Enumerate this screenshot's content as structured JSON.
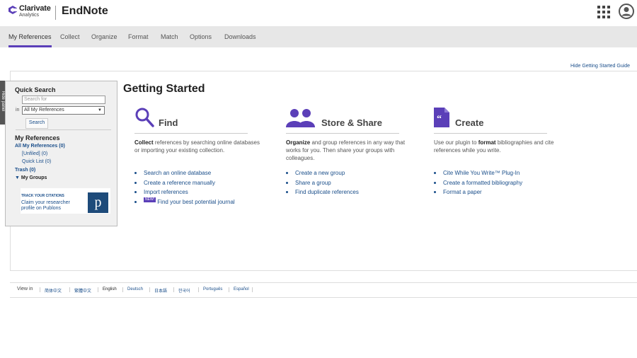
{
  "header": {
    "brand": "Clarivate",
    "brand_sub": "Analytics",
    "app_name": "EndNote",
    "apps_icon": "grid-apps-icon",
    "user_icon": "user-account-icon"
  },
  "nav": {
    "tabs": [
      {
        "label": "My References",
        "active": true
      },
      {
        "label": "Collect"
      },
      {
        "label": "Organize"
      },
      {
        "label": "Format"
      },
      {
        "label": "Match"
      },
      {
        "label": "Options"
      },
      {
        "label": "Downloads"
      }
    ]
  },
  "hide_guide_label": "Hide Getting Started Guide",
  "side_tab_label": "Hide panel",
  "quick_search": {
    "title": "Quick Search",
    "placeholder": "Search for",
    "in_label": "in",
    "select_value": "All My References",
    "button_label": "Search"
  },
  "my_references": {
    "title": "My References",
    "all": "All My References (0)",
    "unfiled": "[Unfiled] (0)",
    "quick_list": "Quick List (0)",
    "trash": "Trash (0)",
    "groups": "My Groups"
  },
  "publons": {
    "line1": "TRACK YOUR CITATIONS",
    "line2": "Claim your researcher",
    "line3": "profile on Publons",
    "logo_letter": "p"
  },
  "getting_started": {
    "title": "Getting Started",
    "find": {
      "icon": "magnifier-icon",
      "heading": "Find",
      "desc_bold": "Collect",
      "desc_rest": " references by searching online databases or importing your existing collection.",
      "links": [
        "Search an online database",
        "Create a reference manually",
        "Import references"
      ],
      "new_badge": "NEW!",
      "new_link": "Find your best potential journal"
    },
    "store": {
      "icon": "group-users-icon",
      "heading": "Store & Share",
      "desc_bold": "Organize",
      "desc_rest": " and group references in any way that works for you. Then share your groups with colleagues.",
      "links": [
        "Create a new group",
        "Share a group",
        "Find duplicate references"
      ]
    },
    "create": {
      "icon": "quote-document-icon",
      "heading": "Create",
      "desc_pre": "Use our plugin to ",
      "desc_bold": "format",
      "desc_rest": " bibliographies and cite references while you write.",
      "links": [
        "Cite While You Write™ Plug-In",
        "Create a formatted bibliography",
        "Format a paper"
      ]
    }
  },
  "languages": {
    "label": "View in",
    "items": [
      "简体中文",
      "繁體中文",
      "English",
      "Deutsch",
      "日本語",
      "한국어",
      "Português",
      "Español"
    ],
    "current": "English"
  }
}
